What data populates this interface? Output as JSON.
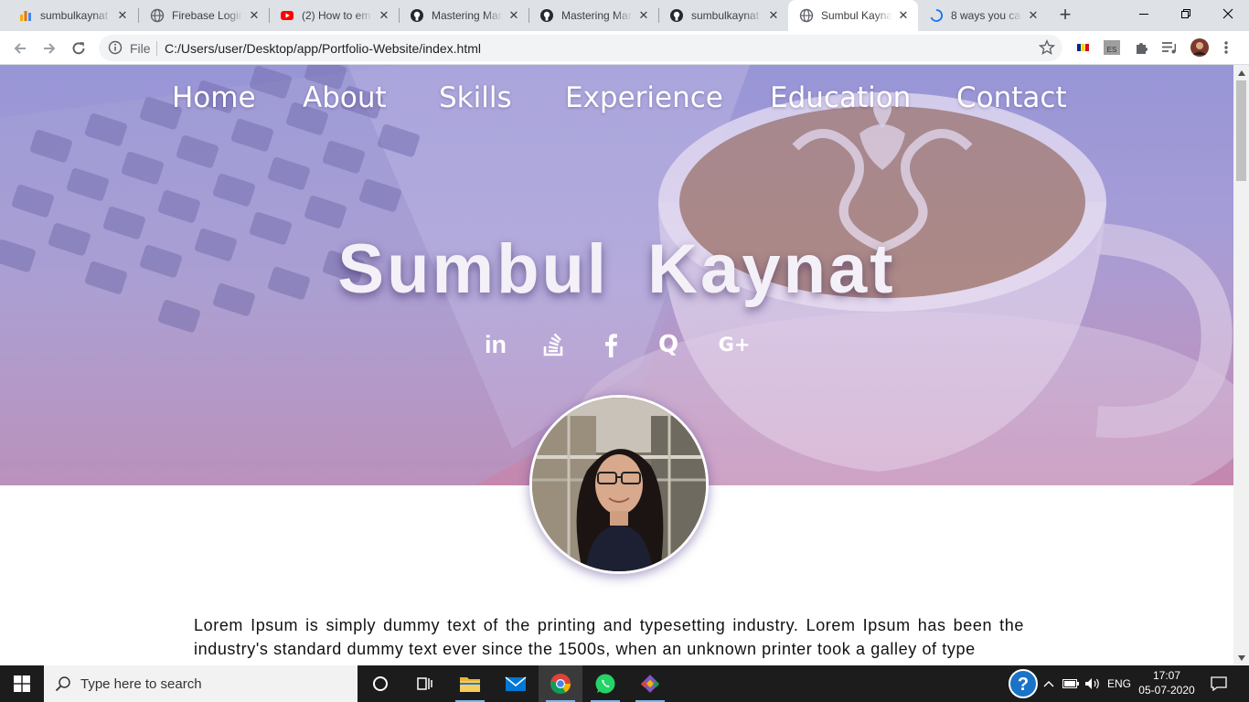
{
  "browser": {
    "tabs": [
      {
        "title": "sumbulkaynat",
        "icon": "analytics-icon",
        "active": false
      },
      {
        "title": "Firebase Login",
        "icon": "globe-icon",
        "active": false
      },
      {
        "title": "(2) How to em",
        "icon": "youtube-icon",
        "active": false
      },
      {
        "title": "Mastering Mar",
        "icon": "github-icon",
        "active": false
      },
      {
        "title": "Mastering Mar",
        "icon": "github-icon",
        "active": false
      },
      {
        "title": "sumbulkaynat",
        "icon": "github-icon",
        "active": false
      },
      {
        "title": "Sumbul Kayna",
        "icon": "globe-icon",
        "active": true
      },
      {
        "title": "8 ways you ca",
        "icon": "loading-icon",
        "active": false
      }
    ],
    "address": {
      "scheme_label": "File",
      "url": "C:/Users/user/Desktop/app/Portfolio-Website/index.html"
    },
    "extension_badge": "ES"
  },
  "page": {
    "nav": [
      "Home",
      "About",
      "Skills",
      "Experience",
      "Education",
      "Contact"
    ],
    "title": "Sumbul Kaynat",
    "social": [
      "linkedin-icon",
      "stackoverflow-icon",
      "facebook-icon",
      "quora-icon",
      "google-plus-icon"
    ],
    "social_labels": {
      "linkedin": "in",
      "quora": "Q",
      "googleplus": "G+"
    },
    "bio": "Lorem Ipsum is simply dummy text of the printing and typesetting industry. Lorem Ipsum has been the industry's standard dummy text ever since the 1500s, when an unknown printer took a galley of type"
  },
  "taskbar": {
    "search_placeholder": "Type here to search",
    "language": "ENG",
    "time": "17:07",
    "date": "05-07-2020"
  },
  "colors": {
    "hero_top": "#9c9cd8",
    "hero_bottom": "#c48fb1",
    "nav_text": "#ffffff",
    "taskbar": "#1c1c1c"
  }
}
